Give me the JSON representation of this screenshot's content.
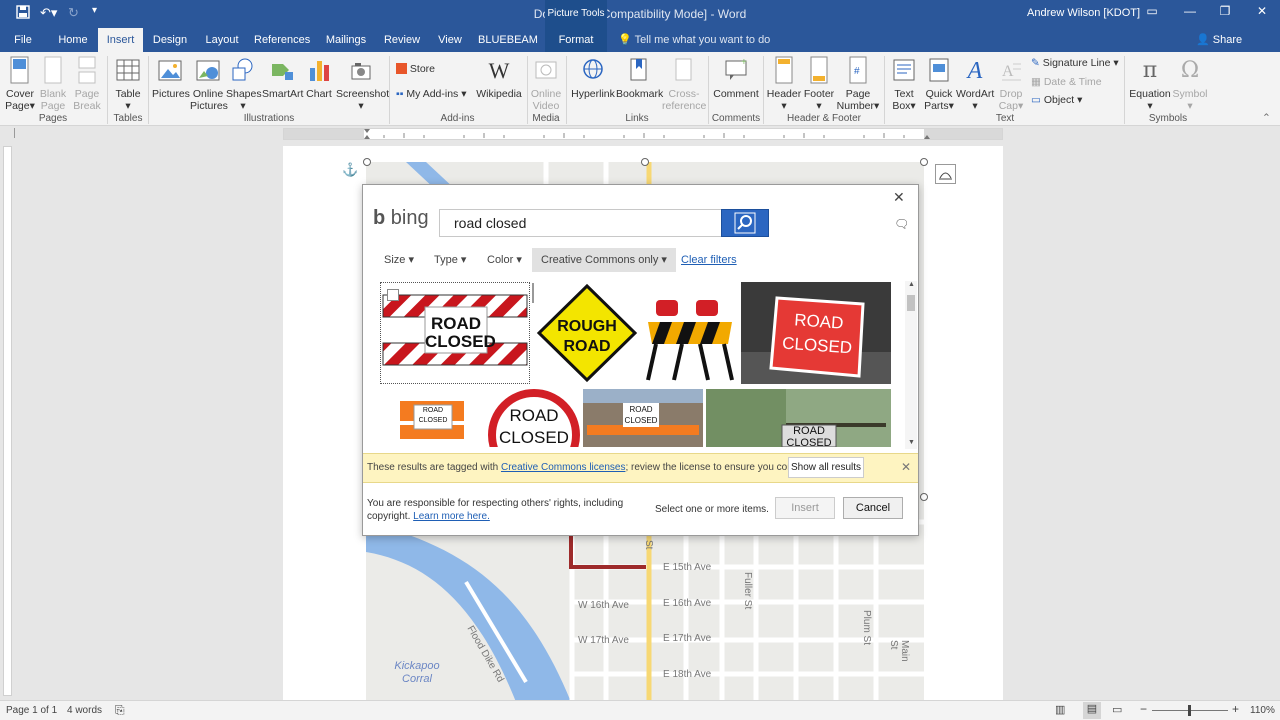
{
  "titlebar": {
    "title": "Document2 [Compatibility Mode]  -  Word",
    "context_tab": "Picture Tools",
    "user": "Andrew Wilson [KDOT]"
  },
  "tabs": [
    "File",
    "Home",
    "Insert",
    "Design",
    "Layout",
    "References",
    "Mailings",
    "Review",
    "View",
    "BLUEBEAM",
    "Format"
  ],
  "tellme": "Tell me what you want to do",
  "share": "Share",
  "ribbon": {
    "pages": {
      "label": "Pages",
      "cover": "Cover",
      "cover2": "Page",
      "blank": "Blank",
      "blank2": "Page",
      "break": "Page",
      "break2": "Break"
    },
    "tables": {
      "label": "Tables",
      "table": "Table"
    },
    "illustrations": {
      "label": "Illustrations",
      "pictures": "Pictures",
      "online": "Online",
      "online2": "Pictures",
      "shapes": "Shapes",
      "smartart": "SmartArt",
      "chart": "Chart",
      "screenshot": "Screenshot"
    },
    "addins": {
      "label": "Add-ins",
      "store": "Store",
      "myaddins": "My Add-ins",
      "wikipedia": "Wikipedia"
    },
    "media": {
      "label": "Media",
      "video": "Online",
      "video2": "Video"
    },
    "links": {
      "label": "Links",
      "hyperlink": "Hyperlink",
      "bookmark": "Bookmark",
      "cross": "Cross-",
      "cross2": "reference"
    },
    "comments": {
      "label": "Comments",
      "comment": "Comment"
    },
    "headerfooter": {
      "label": "Header & Footer",
      "header": "Header",
      "footer": "Footer",
      "pagenum": "Page",
      "pagenum2": "Number"
    },
    "text": {
      "label": "Text",
      "textbox": "Text",
      "textbox2": "Box",
      "quickparts": "Quick",
      "quickparts2": "Parts",
      "wordart": "WordArt",
      "dropcap": "Drop",
      "dropcap2": "Cap",
      "sigline": "Signature Line",
      "datetime": "Date & Time",
      "object": "Object"
    },
    "symbols": {
      "label": "Symbols",
      "equation": "Equation",
      "symbol": "Symbol"
    }
  },
  "dialog": {
    "brand": "bing",
    "search_value": "road closed",
    "filters": {
      "size": "Size",
      "type": "Type",
      "color": "Color",
      "license": "Creative Commons only",
      "clear": "Clear filters"
    },
    "thumbs": {
      "t1": [
        "ROAD",
        "CLOSED"
      ],
      "t2": [
        "ROUGH",
        "ROAD"
      ],
      "t4": [
        "ROAD",
        "CLOSED"
      ],
      "t5": [
        "ROAD",
        "CLOSED"
      ],
      "t6": [
        "ROAD",
        "CLOSED"
      ],
      "t7": [
        "ROAD",
        "CLOSED"
      ],
      "t8": [
        "ROAD",
        "CLOSED"
      ]
    },
    "banner_pre": "These results are tagged with ",
    "banner_link": "Creative Commons licenses",
    "banner_post": "; review the license to ensure you comply.",
    "show_all": "Show all results",
    "footer_text": "You are responsible for respecting others' rights, including copyright. ",
    "learn_more": "Learn more here.",
    "select_text": "Select one or more items.",
    "insert": "Insert",
    "cancel": "Cancel"
  },
  "map": {
    "streets": [
      "E 15th Ave",
      "W 16th Ave",
      "E 16th Ave",
      "W 17th Ave",
      "E 17th Ave",
      "E 18th Ave",
      "Flood Dike Rd",
      "Fuller St",
      "Plum St",
      "Main St",
      "St"
    ],
    "park": "Kickapoo Corral"
  },
  "status": {
    "page": "Page 1 of 1",
    "words": "4 words",
    "zoom": "110%"
  },
  "colors": {
    "accent": "#2b579a",
    "search": "#2b66c1",
    "banner": "#fef4c1"
  }
}
